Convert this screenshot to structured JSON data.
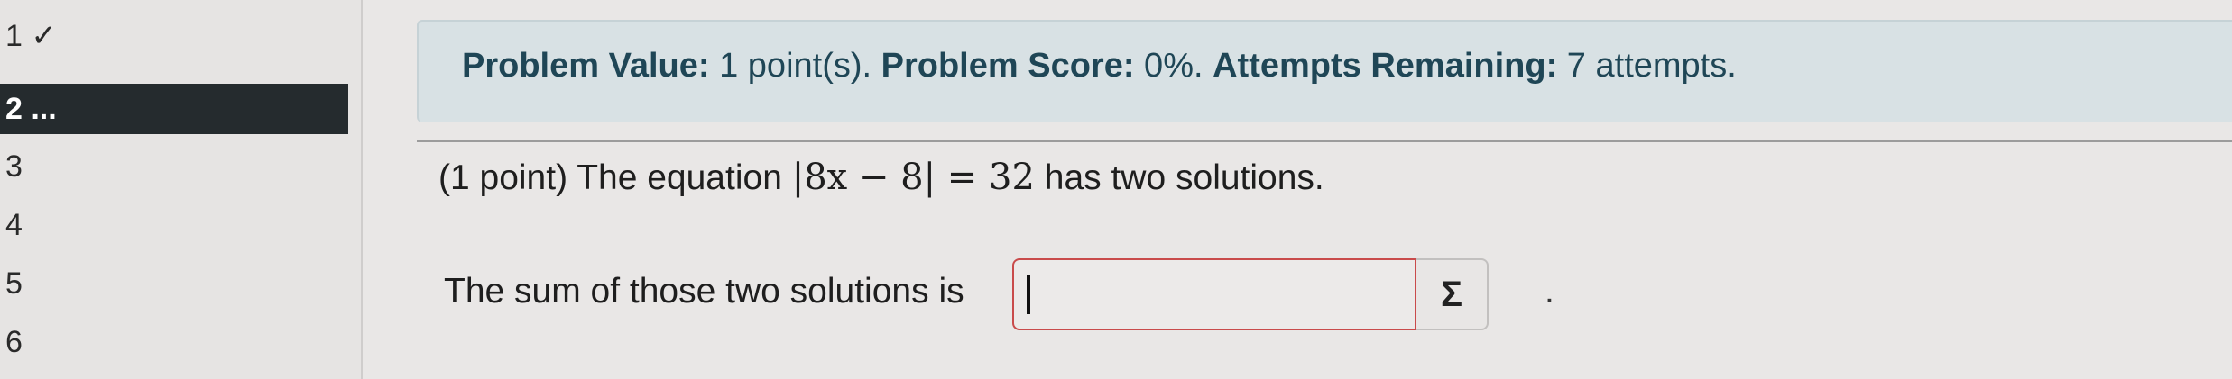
{
  "sidebar": {
    "items": [
      {
        "label": "1 ✓"
      },
      {
        "label": "2 ..."
      },
      {
        "label": "3"
      },
      {
        "label": "4"
      },
      {
        "label": "5"
      },
      {
        "label": "6"
      }
    ],
    "active_index": 1
  },
  "banner": {
    "value_label": "Problem Value:",
    "value_text": " 1 point(s). ",
    "score_label": "Problem Score:",
    "score_text": " 0%. ",
    "attempts_label": "Attempts Remaining:",
    "attempts_text": " 7 attempts."
  },
  "problem": {
    "prefix": "(1 point) The equation ",
    "equation": "|8x − 8| = 32",
    "suffix": " has two solutions."
  },
  "answer": {
    "prompt": "The sum of those two solutions is",
    "value": "",
    "equation_icon": "Σ",
    "trailing": "."
  }
}
